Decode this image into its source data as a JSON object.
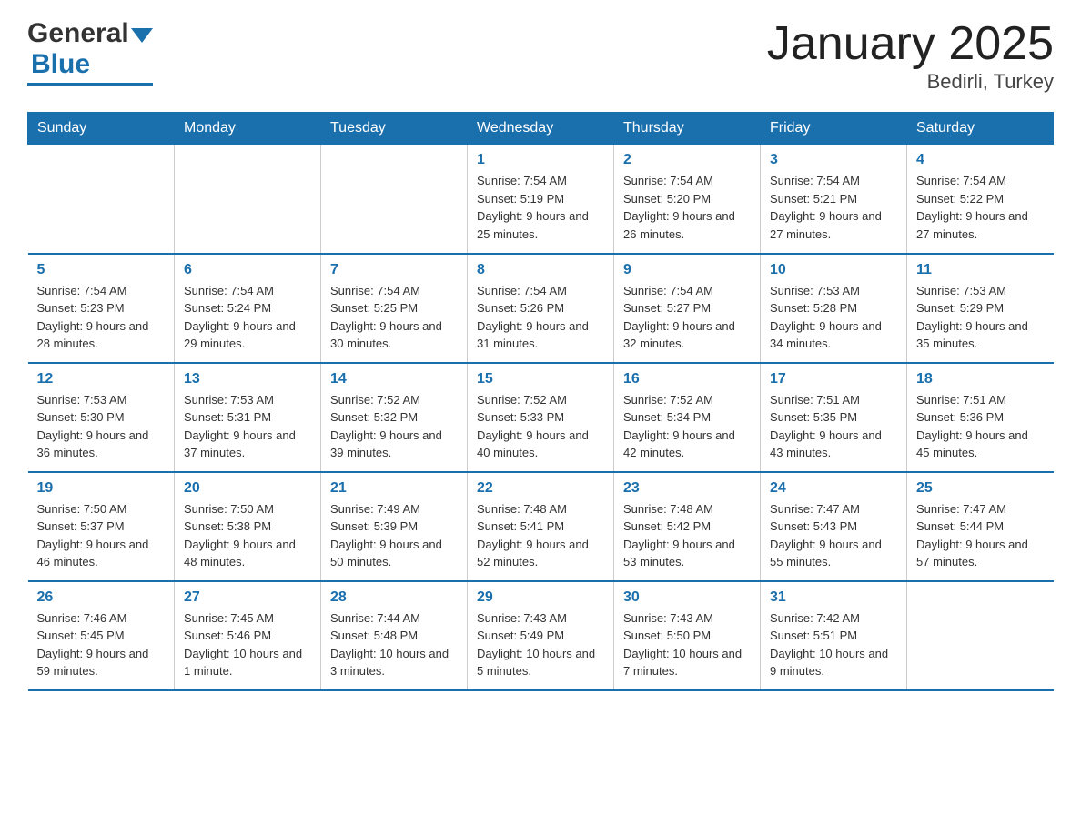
{
  "header": {
    "logo_general": "General",
    "logo_blue": "Blue",
    "title": "January 2025",
    "subtitle": "Bedirli, Turkey"
  },
  "days_of_week": [
    "Sunday",
    "Monday",
    "Tuesday",
    "Wednesday",
    "Thursday",
    "Friday",
    "Saturday"
  ],
  "weeks": [
    [
      {
        "day": "",
        "sunrise": "",
        "sunset": "",
        "daylight": ""
      },
      {
        "day": "",
        "sunrise": "",
        "sunset": "",
        "daylight": ""
      },
      {
        "day": "",
        "sunrise": "",
        "sunset": "",
        "daylight": ""
      },
      {
        "day": "1",
        "sunrise": "Sunrise: 7:54 AM",
        "sunset": "Sunset: 5:19 PM",
        "daylight": "Daylight: 9 hours and 25 minutes."
      },
      {
        "day": "2",
        "sunrise": "Sunrise: 7:54 AM",
        "sunset": "Sunset: 5:20 PM",
        "daylight": "Daylight: 9 hours and 26 minutes."
      },
      {
        "day": "3",
        "sunrise": "Sunrise: 7:54 AM",
        "sunset": "Sunset: 5:21 PM",
        "daylight": "Daylight: 9 hours and 27 minutes."
      },
      {
        "day": "4",
        "sunrise": "Sunrise: 7:54 AM",
        "sunset": "Sunset: 5:22 PM",
        "daylight": "Daylight: 9 hours and 27 minutes."
      }
    ],
    [
      {
        "day": "5",
        "sunrise": "Sunrise: 7:54 AM",
        "sunset": "Sunset: 5:23 PM",
        "daylight": "Daylight: 9 hours and 28 minutes."
      },
      {
        "day": "6",
        "sunrise": "Sunrise: 7:54 AM",
        "sunset": "Sunset: 5:24 PM",
        "daylight": "Daylight: 9 hours and 29 minutes."
      },
      {
        "day": "7",
        "sunrise": "Sunrise: 7:54 AM",
        "sunset": "Sunset: 5:25 PM",
        "daylight": "Daylight: 9 hours and 30 minutes."
      },
      {
        "day": "8",
        "sunrise": "Sunrise: 7:54 AM",
        "sunset": "Sunset: 5:26 PM",
        "daylight": "Daylight: 9 hours and 31 minutes."
      },
      {
        "day": "9",
        "sunrise": "Sunrise: 7:54 AM",
        "sunset": "Sunset: 5:27 PM",
        "daylight": "Daylight: 9 hours and 32 minutes."
      },
      {
        "day": "10",
        "sunrise": "Sunrise: 7:53 AM",
        "sunset": "Sunset: 5:28 PM",
        "daylight": "Daylight: 9 hours and 34 minutes."
      },
      {
        "day": "11",
        "sunrise": "Sunrise: 7:53 AM",
        "sunset": "Sunset: 5:29 PM",
        "daylight": "Daylight: 9 hours and 35 minutes."
      }
    ],
    [
      {
        "day": "12",
        "sunrise": "Sunrise: 7:53 AM",
        "sunset": "Sunset: 5:30 PM",
        "daylight": "Daylight: 9 hours and 36 minutes."
      },
      {
        "day": "13",
        "sunrise": "Sunrise: 7:53 AM",
        "sunset": "Sunset: 5:31 PM",
        "daylight": "Daylight: 9 hours and 37 minutes."
      },
      {
        "day": "14",
        "sunrise": "Sunrise: 7:52 AM",
        "sunset": "Sunset: 5:32 PM",
        "daylight": "Daylight: 9 hours and 39 minutes."
      },
      {
        "day": "15",
        "sunrise": "Sunrise: 7:52 AM",
        "sunset": "Sunset: 5:33 PM",
        "daylight": "Daylight: 9 hours and 40 minutes."
      },
      {
        "day": "16",
        "sunrise": "Sunrise: 7:52 AM",
        "sunset": "Sunset: 5:34 PM",
        "daylight": "Daylight: 9 hours and 42 minutes."
      },
      {
        "day": "17",
        "sunrise": "Sunrise: 7:51 AM",
        "sunset": "Sunset: 5:35 PM",
        "daylight": "Daylight: 9 hours and 43 minutes."
      },
      {
        "day": "18",
        "sunrise": "Sunrise: 7:51 AM",
        "sunset": "Sunset: 5:36 PM",
        "daylight": "Daylight: 9 hours and 45 minutes."
      }
    ],
    [
      {
        "day": "19",
        "sunrise": "Sunrise: 7:50 AM",
        "sunset": "Sunset: 5:37 PM",
        "daylight": "Daylight: 9 hours and 46 minutes."
      },
      {
        "day": "20",
        "sunrise": "Sunrise: 7:50 AM",
        "sunset": "Sunset: 5:38 PM",
        "daylight": "Daylight: 9 hours and 48 minutes."
      },
      {
        "day": "21",
        "sunrise": "Sunrise: 7:49 AM",
        "sunset": "Sunset: 5:39 PM",
        "daylight": "Daylight: 9 hours and 50 minutes."
      },
      {
        "day": "22",
        "sunrise": "Sunrise: 7:48 AM",
        "sunset": "Sunset: 5:41 PM",
        "daylight": "Daylight: 9 hours and 52 minutes."
      },
      {
        "day": "23",
        "sunrise": "Sunrise: 7:48 AM",
        "sunset": "Sunset: 5:42 PM",
        "daylight": "Daylight: 9 hours and 53 minutes."
      },
      {
        "day": "24",
        "sunrise": "Sunrise: 7:47 AM",
        "sunset": "Sunset: 5:43 PM",
        "daylight": "Daylight: 9 hours and 55 minutes."
      },
      {
        "day": "25",
        "sunrise": "Sunrise: 7:47 AM",
        "sunset": "Sunset: 5:44 PM",
        "daylight": "Daylight: 9 hours and 57 minutes."
      }
    ],
    [
      {
        "day": "26",
        "sunrise": "Sunrise: 7:46 AM",
        "sunset": "Sunset: 5:45 PM",
        "daylight": "Daylight: 9 hours and 59 minutes."
      },
      {
        "day": "27",
        "sunrise": "Sunrise: 7:45 AM",
        "sunset": "Sunset: 5:46 PM",
        "daylight": "Daylight: 10 hours and 1 minute."
      },
      {
        "day": "28",
        "sunrise": "Sunrise: 7:44 AM",
        "sunset": "Sunset: 5:48 PM",
        "daylight": "Daylight: 10 hours and 3 minutes."
      },
      {
        "day": "29",
        "sunrise": "Sunrise: 7:43 AM",
        "sunset": "Sunset: 5:49 PM",
        "daylight": "Daylight: 10 hours and 5 minutes."
      },
      {
        "day": "30",
        "sunrise": "Sunrise: 7:43 AM",
        "sunset": "Sunset: 5:50 PM",
        "daylight": "Daylight: 10 hours and 7 minutes."
      },
      {
        "day": "31",
        "sunrise": "Sunrise: 7:42 AM",
        "sunset": "Sunset: 5:51 PM",
        "daylight": "Daylight: 10 hours and 9 minutes."
      },
      {
        "day": "",
        "sunrise": "",
        "sunset": "",
        "daylight": ""
      }
    ]
  ]
}
